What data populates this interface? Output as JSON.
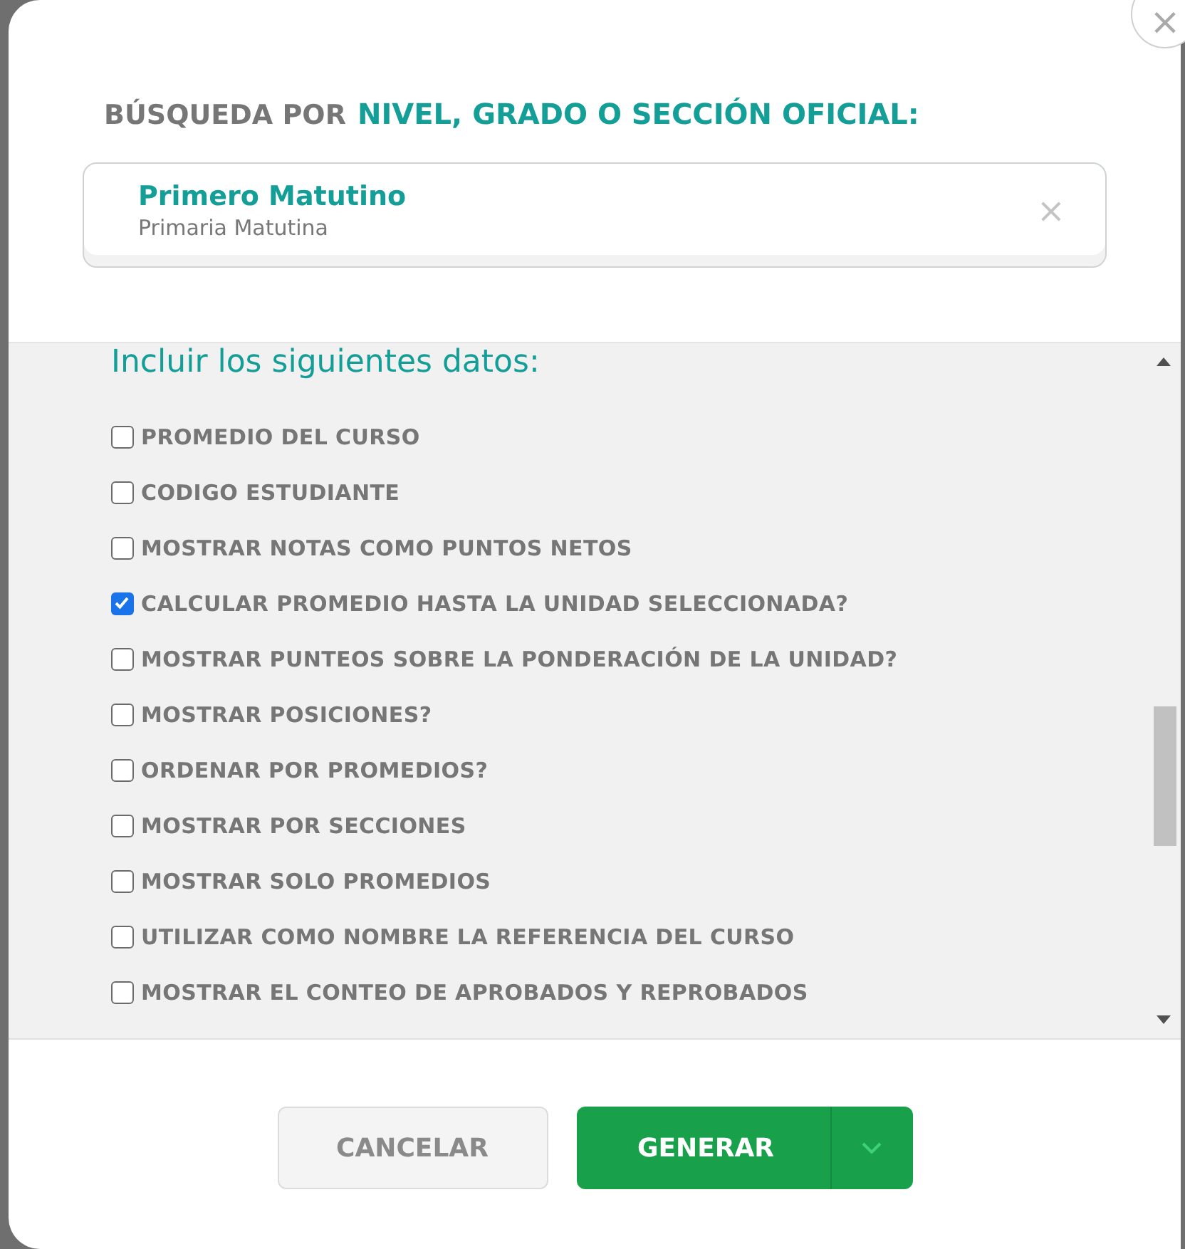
{
  "dialog": {
    "close": "×",
    "heading": {
      "prefix": "BÚSQUEDA POR",
      "highlight": "NIVEL, GRADO O SECCIÓN OFICIAL:"
    },
    "selection": {
      "title": "Primero Matutino",
      "subtitle": "Primaria Matutina",
      "clear": "×"
    },
    "options_title": "Incluir los siguientes datos:",
    "options": [
      {
        "kind": "checkbox",
        "label": "PROMEDIO DEL CURSO",
        "checked": false
      },
      {
        "kind": "checkbox",
        "label": "CODIGO ESTUDIANTE",
        "checked": false
      },
      {
        "kind": "checkbox",
        "label": "MOSTRAR NOTAS COMO PUNTOS NETOS",
        "checked": false
      },
      {
        "kind": "checkbox",
        "label": "CALCULAR PROMEDIO HASTA LA UNIDAD SELECCIONADA?",
        "checked": true
      },
      {
        "kind": "checkbox",
        "label": "MOSTRAR PUNTEOS SOBRE LA PONDERACIÓN DE LA UNIDAD?",
        "checked": false
      },
      {
        "kind": "checkbox",
        "label": "MOSTRAR POSICIONES?",
        "checked": false
      },
      {
        "kind": "checkbox",
        "label": "ORDENAR POR PROMEDIOS?",
        "checked": false
      },
      {
        "kind": "checkbox",
        "label": "MOSTRAR POR SECCIONES",
        "checked": false
      },
      {
        "kind": "checkbox",
        "label": "MOSTRAR SOLO PROMEDIOS",
        "checked": false
      },
      {
        "kind": "checkbox",
        "label": "UTILIZAR COMO NOMBRE LA REFERENCIA DEL CURSO",
        "checked": false
      },
      {
        "kind": "checkbox",
        "label": "MOSTRAR EL CONTEO DE APROBADOS Y REPROBADOS",
        "checked": false
      }
    ],
    "buttons": [
      {
        "kind": "secondary",
        "label": "CANCELAR"
      },
      {
        "kind": "primary",
        "label": "GENERAR"
      }
    ]
  }
}
